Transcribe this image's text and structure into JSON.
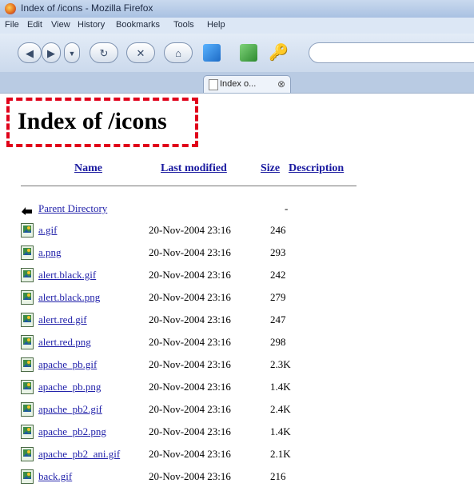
{
  "window": {
    "title": "Index of /icons - Mozilla Firefox"
  },
  "menu": [
    "File",
    "Edit",
    "View",
    "History",
    "Bookmarks",
    "Tools",
    "Help"
  ],
  "tab": {
    "label": "Index o..."
  },
  "page": {
    "title": "Index of /icons"
  },
  "table": {
    "headers": {
      "name": "Name",
      "modified": "Last modified",
      "size": "Size",
      "description": "Description"
    },
    "parent": {
      "name": "Parent Directory",
      "size": "-"
    },
    "rows": [
      {
        "name": "a.gif",
        "modified": "20-Nov-2004 23:16",
        "size": "246"
      },
      {
        "name": "a.png",
        "modified": "20-Nov-2004 23:16",
        "size": "293"
      },
      {
        "name": "alert.black.gif",
        "modified": "20-Nov-2004 23:16",
        "size": "242"
      },
      {
        "name": "alert.black.png",
        "modified": "20-Nov-2004 23:16",
        "size": "279"
      },
      {
        "name": "alert.red.gif",
        "modified": "20-Nov-2004 23:16",
        "size": "247"
      },
      {
        "name": "alert.red.png",
        "modified": "20-Nov-2004 23:16",
        "size": "298"
      },
      {
        "name": "apache_pb.gif",
        "modified": "20-Nov-2004 23:16",
        "size": "2.3K"
      },
      {
        "name": "apache_pb.png",
        "modified": "20-Nov-2004 23:16",
        "size": "1.4K"
      },
      {
        "name": "apache_pb2.gif",
        "modified": "20-Nov-2004 23:16",
        "size": "2.4K"
      },
      {
        "name": "apache_pb2.png",
        "modified": "20-Nov-2004 23:16",
        "size": "1.4K"
      },
      {
        "name": "apache_pb2_ani.gif",
        "modified": "20-Nov-2004 23:16",
        "size": "2.1K"
      },
      {
        "name": "back.gif",
        "modified": "20-Nov-2004 23:16",
        "size": "216"
      }
    ]
  },
  "colors": {
    "highlight": "#e0001a",
    "link": "#2222aa"
  }
}
